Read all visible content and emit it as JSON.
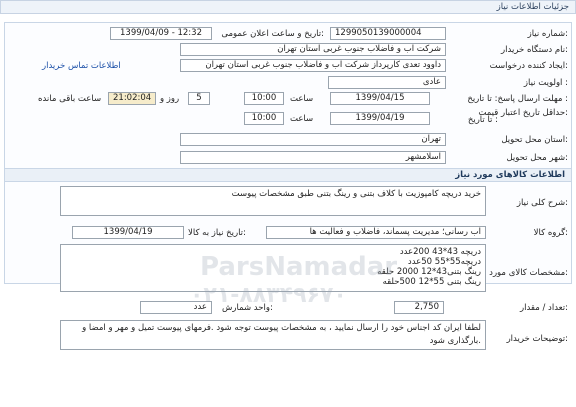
{
  "header": {
    "title": "جزئیات اطلاعات نیاز"
  },
  "fields": {
    "need_number_label": "شماره نیاز:",
    "need_number": "1299050139000004",
    "announce_label": "تاریخ و ساعت اعلان عمومی:",
    "announce_value": "1399/04/09 - 12:32",
    "buyer_label": "نام دستگاه خریدار:",
    "buyer": "شرکت آب و فاضلاب جنوب غربی استان تهران",
    "creator_label": "ایجاد کننده درخواست:",
    "creator": "داوود  تعدی  کارپرداز شرکت آب و فاضلاب جنوب غربی استان تهران",
    "contact_link": "اطلاعات تماس خریدار",
    "priority_label": "اولویت نیاز :",
    "priority": "عادی",
    "deadline_label": "مهلت ارسال پاسخ: تا تاریخ :",
    "deadline_date": "1399/04/15",
    "time_word": "ساعت",
    "deadline_time": "10:00",
    "days": "5",
    "day_word": "روز و",
    "remaining_time": "21:02:04",
    "remaining_label": "ساعت باقی مانده",
    "validity_label": "حداقل تاریخ اعتبار قیمت:",
    "validity_prefix": "تا تاریخ :",
    "validity_date": "1399/04/19",
    "validity_time": "10:00",
    "province_label": "استان محل تحویل:",
    "province": "تهران",
    "city_label": "شهر محل تحویل:",
    "city": "اسلامشهر"
  },
  "goods": {
    "section_title": "اطلاعات کالاهای مورد نیاز",
    "summary_label": "شرح کلی نیاز:",
    "summary": "خرید دریچه کامپوزیت با کلاف بتنی و رینگ بتنی طبق مشخصات پیوست",
    "group_label": "گروه کالا:",
    "group": "آب رسانی؛ مدیریت پسماند، فاضلاب و فعالیت ها",
    "need_date_label": "تاریخ نیاز به کالا:",
    "need_date": "1399/04/19",
    "specs_label": "مشخصات کالای مورد نیاز:",
    "specs": "دریچه 43*43  200عدد\nدریچه55*55    50عدد\nرینگ بتنی43*12  2000 حلقه\nرینگ بتنی 55*12     500حلقه",
    "qty_label": "تعداد / مقدار:",
    "qty": "2,750",
    "unit_label": "واحد شمارش:",
    "unit": "عدد",
    "desc_label": "توضیحات خریدار:",
    "desc": "لطفا ایران کد اجناس خود را ارسال نمایید ، به مشخصات پیوست توجه شود .فرمهای پیوست تمیل و مهر و امضا و بارگذاری شود."
  },
  "watermark": {
    "brand": "ParsNamadar",
    "phone": "۰۲۱-۸۸۳۴۹۶۷۰"
  }
}
